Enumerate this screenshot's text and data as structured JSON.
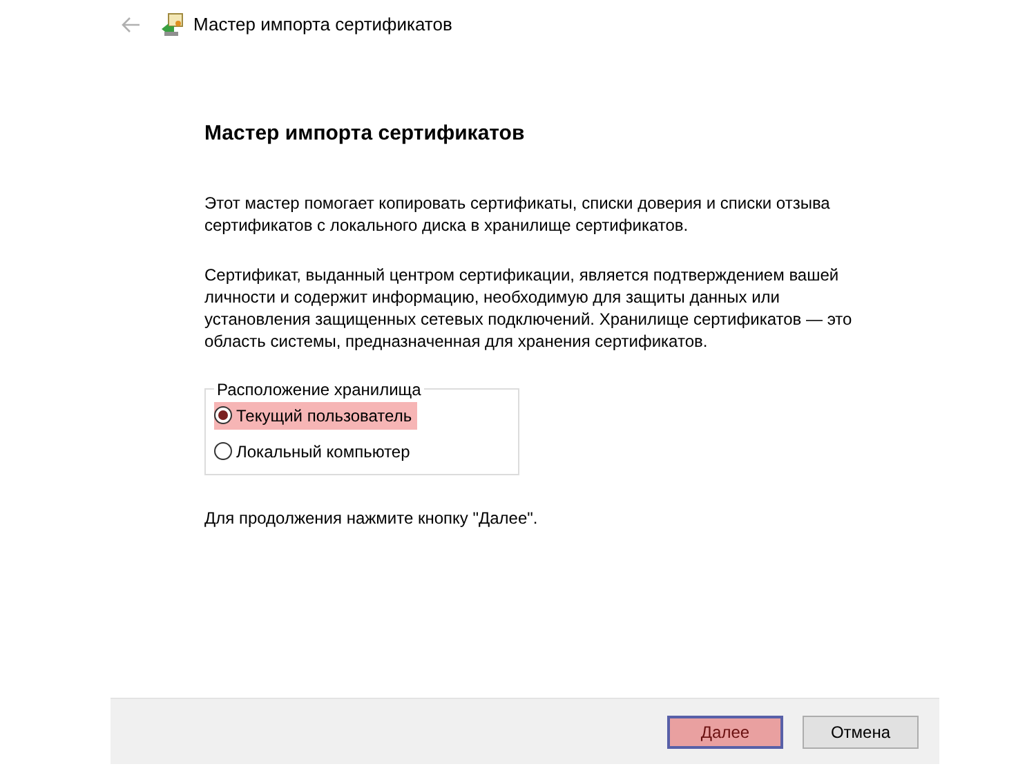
{
  "window": {
    "title": "Мастер импорта сертификатов"
  },
  "heading": "Мастер импорта сертификатов",
  "paragraphs": [
    "Этот мастер помогает копировать сертификаты, списки доверия и списки отзыва сертификатов с локального диска в хранилище сертификатов.",
    "Сертификат, выданный центром сертификации, является подтверждением вашей личности и содержит информацию, необходимую для защиты данных или установления защищенных сетевых подключений. Хранилище сертификатов — это область системы, предназначенная для хранения сертификатов."
  ],
  "store_location": {
    "legend": "Расположение хранилища",
    "options": [
      {
        "label": "Текущий пользователь",
        "selected": true,
        "highlighted": true
      },
      {
        "label": "Локальный компьютер",
        "selected": false,
        "highlighted": false
      }
    ]
  },
  "hint": "Для продолжения нажмите кнопку \"Далее\".",
  "buttons": [
    {
      "label": "Далее",
      "default": true,
      "highlighted": true
    },
    {
      "label": "Отмена",
      "default": false,
      "highlighted": false
    }
  ]
}
